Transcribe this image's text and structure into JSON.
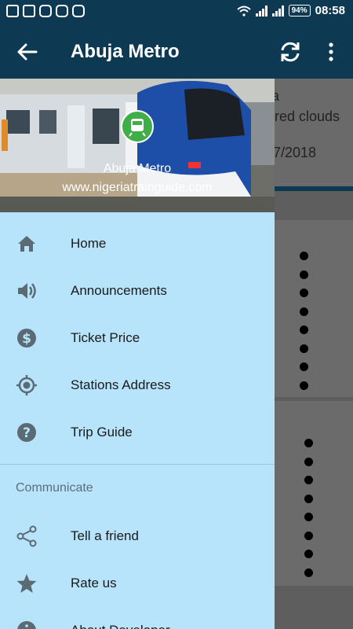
{
  "status_bar": {
    "battery": "94%",
    "time": "08:58"
  },
  "app_bar": {
    "title": "Abuja Metro"
  },
  "background": {
    "line1": "a",
    "line2": "red clouds",
    "line3": "7/2018"
  },
  "drawer": {
    "header_title": "Abuja Metro",
    "header_subtitle": "www.nigeriatrainguide.com",
    "items": [
      {
        "label": "Home",
        "icon": "home-icon"
      },
      {
        "label": "Announcements",
        "icon": "speaker-icon"
      },
      {
        "label": "Ticket Price",
        "icon": "dollar-icon"
      },
      {
        "label": "Stations Address",
        "icon": "location-target-icon"
      },
      {
        "label": "Trip Guide",
        "icon": "help-icon"
      }
    ],
    "section_title": "Communicate",
    "communicate_items": [
      {
        "label": "Tell a friend",
        "icon": "share-icon"
      },
      {
        "label": "Rate us",
        "icon": "star-icon"
      },
      {
        "label": "About Developer",
        "icon": "info-icon"
      }
    ]
  },
  "colors": {
    "primary": "#0d3a52",
    "drawer_bg": "#b8e4fb",
    "icon": "#5a6b73",
    "logo_green": "#3fae49"
  }
}
